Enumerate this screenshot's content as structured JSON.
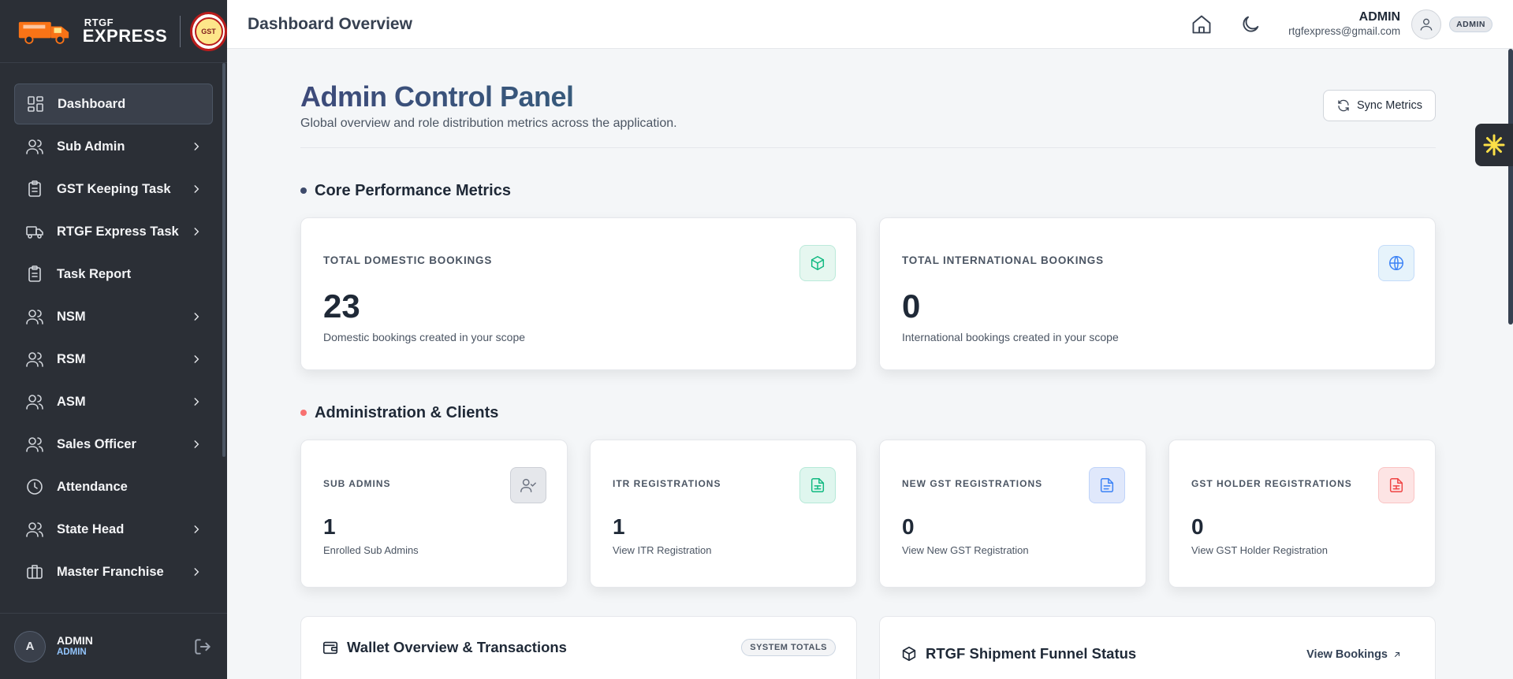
{
  "brand": {
    "line1": "RTGF",
    "line2": "EXPRESS",
    "seal_text": "GST"
  },
  "sidebar": {
    "items": [
      {
        "label": "Dashboard",
        "icon": "grid-icon",
        "active": true,
        "chevron": false
      },
      {
        "label": "Sub Admin",
        "icon": "users-icon",
        "chevron": true
      },
      {
        "label": "GST Keeping Task",
        "icon": "clipboard-icon",
        "chevron": true
      },
      {
        "label": "RTGF Express Task",
        "icon": "truck-icon",
        "chevron": true
      },
      {
        "label": "Task Report",
        "icon": "clipboard-icon",
        "chevron": false
      },
      {
        "label": "NSM",
        "icon": "users-icon",
        "chevron": true
      },
      {
        "label": "RSM",
        "icon": "users-icon",
        "chevron": true
      },
      {
        "label": "ASM",
        "icon": "users-icon",
        "chevron": true
      },
      {
        "label": "Sales Officer",
        "icon": "users-icon",
        "chevron": true
      },
      {
        "label": "Attendance",
        "icon": "clock-icon",
        "chevron": false
      },
      {
        "label": "State Head",
        "icon": "users-icon",
        "chevron": true
      },
      {
        "label": "Master Franchise",
        "icon": "briefcase-icon",
        "chevron": true
      }
    ],
    "footer": {
      "initial": "A",
      "name": "ADMIN",
      "role": "ADMIN"
    }
  },
  "header": {
    "title": "Dashboard Overview",
    "user_name": "ADMIN",
    "user_email": "rtgfexpress@gmail.com",
    "role_badge": "ADMIN"
  },
  "hero": {
    "title": "Admin Control Panel",
    "subtitle": "Global overview and role distribution metrics across the application.",
    "sync_label": "Sync Metrics"
  },
  "sections": {
    "core": {
      "title": "Core Performance Metrics",
      "dot_color": "#3d4a6b"
    },
    "admin": {
      "title": "Administration & Clients",
      "dot_color": "#f87171"
    }
  },
  "core_cards": [
    {
      "caption": "TOTAL DOMESTIC BOOKINGS",
      "value": "23",
      "desc": "Domestic bookings created in your scope",
      "icon": "box-icon",
      "bg": "#e6f7f0",
      "fg": "#10b981"
    },
    {
      "caption": "TOTAL INTERNATIONAL BOOKINGS",
      "value": "0",
      "desc": "International bookings created in your scope",
      "icon": "globe-icon",
      "bg": "#e6f3fb",
      "fg": "#3b82f6"
    }
  ],
  "admin_cards": [
    {
      "caption": "SUB ADMINS",
      "value": "1",
      "desc": "Enrolled Sub Admins",
      "icon": "user-check-icon",
      "bg": "#e5e7eb",
      "fg": "#6b7280"
    },
    {
      "caption": "ITR REGISTRATIONS",
      "value": "1",
      "desc": "View ITR Registration",
      "icon": "file-sheet-icon",
      "bg": "#dff6ee",
      "fg": "#10b981"
    },
    {
      "caption": "NEW GST REGISTRATIONS",
      "value": "0",
      "desc": "View New GST Registration",
      "icon": "file-text-icon",
      "bg": "#e0e8fb",
      "fg": "#3b82f6"
    },
    {
      "caption": "GST HOLDER REGISTRATIONS",
      "value": "0",
      "desc": "View GST Holder Registration",
      "icon": "file-sheet-icon",
      "bg": "#fde4e4",
      "fg": "#ef4444"
    }
  ],
  "bottom": {
    "wallet": {
      "title": "Wallet Overview & Transactions",
      "tag": "SYSTEM TOTALS"
    },
    "funnel": {
      "title": "RTGF Shipment Funnel Status",
      "link": "View Bookings"
    }
  }
}
